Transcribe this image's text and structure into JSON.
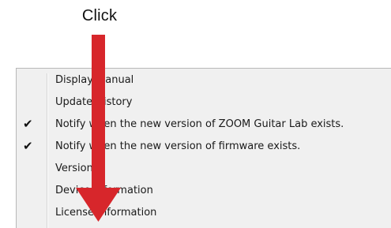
{
  "caption": "Click",
  "menu": {
    "items": [
      {
        "label": "Display Manual",
        "checked": false
      },
      {
        "label": "Update History",
        "checked": false
      },
      {
        "label": "Notify when the new version of ZOOM Guitar Lab exists.",
        "checked": true
      },
      {
        "label": "Notify when the new version of firmware exists.",
        "checked": true
      },
      {
        "label": "Version",
        "checked": false
      },
      {
        "label": "Device Information",
        "checked": false
      },
      {
        "label": "License Information",
        "checked": false
      }
    ],
    "check_glyph": "✔"
  },
  "colors": {
    "arrow": "#d7262b",
    "menu_bg": "#f0f0f0"
  }
}
